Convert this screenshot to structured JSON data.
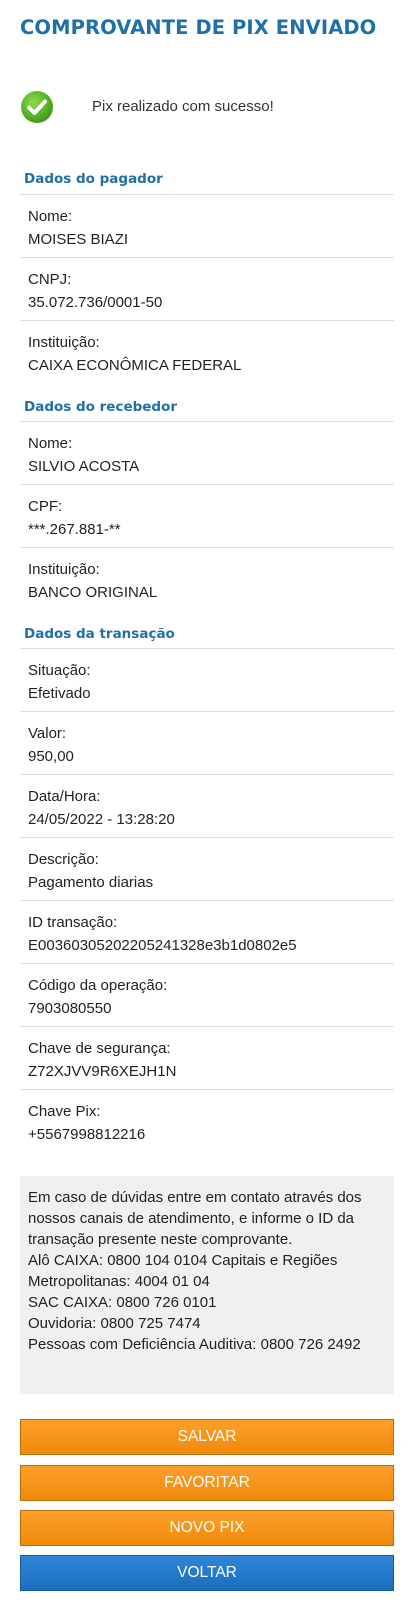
{
  "header": {
    "title": "COMPROVANTE DE PIX ENVIADO"
  },
  "status": {
    "message": "Pix realizado com sucesso!",
    "icon": "check-circle-icon",
    "icon_color": "#5cb82a"
  },
  "payer": {
    "heading": "Dados do pagador",
    "fields": [
      {
        "label": "Nome:",
        "value": "MOISES BIAZI"
      },
      {
        "label": "CNPJ:",
        "value": "35.072.736/0001-50"
      },
      {
        "label": "Instituição:",
        "value": "CAIXA ECONÔMICA FEDERAL"
      }
    ]
  },
  "receiver": {
    "heading": "Dados do recebedor",
    "fields": [
      {
        "label": "Nome:",
        "value": "SILVIO ACOSTA"
      },
      {
        "label": "CPF:",
        "value": "***.267.881-**"
      },
      {
        "label": "Instituição:",
        "value": "BANCO ORIGINAL"
      }
    ]
  },
  "transaction": {
    "heading": "Dados da transação",
    "fields": [
      {
        "label": "Situação:",
        "value": "Efetivado"
      },
      {
        "label": "Valor:",
        "value": "950,00"
      },
      {
        "label": "Data/Hora:",
        "value": "24/05/2022 - 13:28:20"
      },
      {
        "label": "Descrição:",
        "value": "Pagamento diarias"
      },
      {
        "label": "ID transação:",
        "value": "E00360305202205241328e3b1d0802e5"
      },
      {
        "label": "Código da operação:",
        "value": "7903080550"
      },
      {
        "label": "Chave de segurança:",
        "value": "Z72XJVV9R6XEJH1N"
      },
      {
        "label": "Chave Pix:",
        "value": "+5567998812216"
      }
    ]
  },
  "info": {
    "intro": "Em caso de dúvidas entre em contato através dos nossos canais de atendimento, e informe o ID da transação presente neste comprovante.",
    "alo": "Alô CAIXA: 0800 104 0104 Capitais e Regiões Metropolitanas: 4004 01 04",
    "sac": "SAC CAIXA: 0800 726 0101",
    "ouvidoria": "Ouvidoria: 0800 725 7474",
    "deficiencia": "Pessoas com Deficiência Auditiva: 0800 726 2492"
  },
  "buttons": {
    "salvar": "SALVAR",
    "favoritar": "FAVORITAR",
    "novo_pix": "NOVO PIX",
    "voltar": "VOLTAR"
  },
  "colors": {
    "brand_blue": "#1f6fa8",
    "orange": "#f7941d",
    "button_blue": "#1f78c8"
  }
}
